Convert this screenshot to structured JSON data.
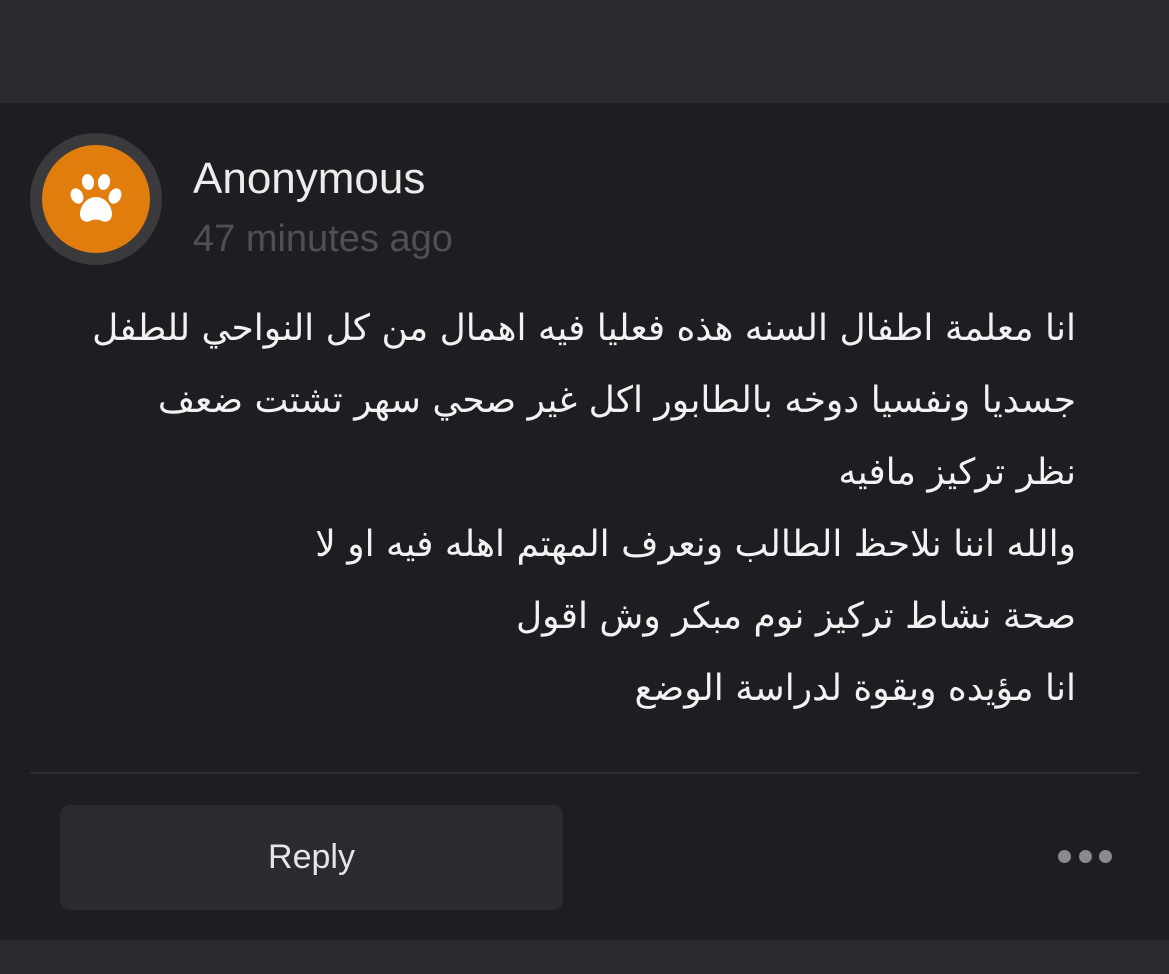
{
  "comment": {
    "author": "Anonymous",
    "timestamp": "47 minutes ago",
    "avatar_icon": "paw-icon",
    "avatar_color": "#e07d0c",
    "lines": [
      "انا معلمة اطفال السنه هذه فعليا فيه اهمال من كل النواحي للطفل",
      "جسديا ونفسيا دوخه بالطابور اكل غير صحي سهر تشتت ضعف",
      "نظر تركيز مافيه",
      "والله اننا نلاحظ الطالب ونعرف المهتم اهله فيه او لا",
      "صحة نشاط تركيز نوم مبكر وش اقول",
      "انا مؤيده وبقوة لدراسة الوضع"
    ]
  },
  "actions": {
    "reply_label": "Reply",
    "more_icon": "more-horizontal-icon"
  }
}
